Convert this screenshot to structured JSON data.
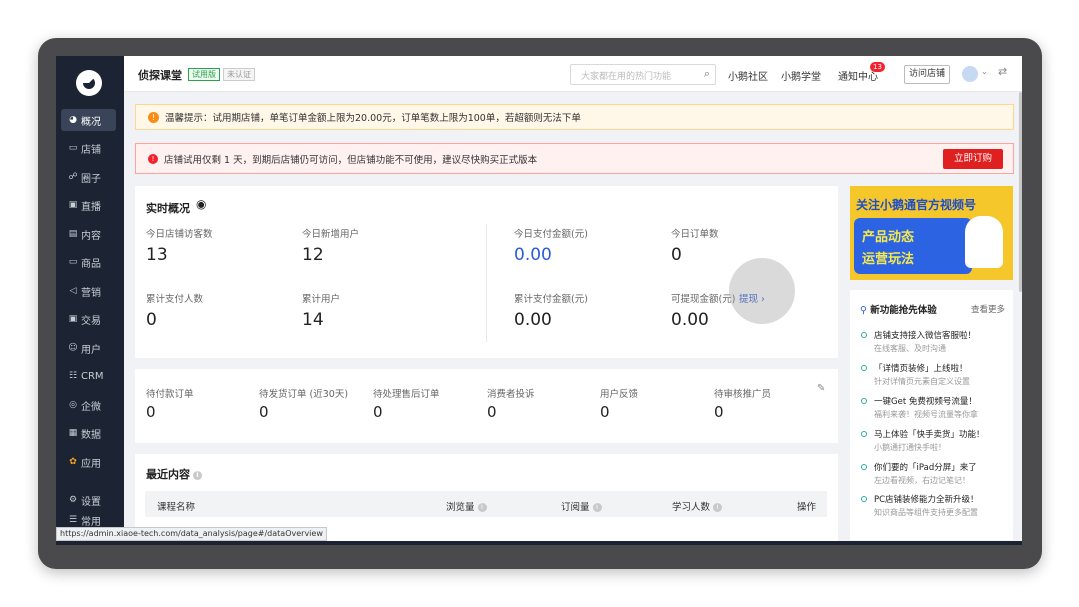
{
  "sidebar": {
    "items": [
      {
        "label": "概况",
        "icon": "pie-chart-icon"
      },
      {
        "label": "店铺",
        "icon": "store-icon"
      },
      {
        "label": "圈子",
        "icon": "community-icon"
      },
      {
        "label": "直播",
        "icon": "live-icon"
      },
      {
        "label": "内容",
        "icon": "content-icon"
      },
      {
        "label": "商品",
        "icon": "goods-icon"
      },
      {
        "label": "营销",
        "icon": "megaphone-icon"
      },
      {
        "label": "交易",
        "icon": "trade-icon"
      },
      {
        "label": "用户",
        "icon": "user-icon"
      },
      {
        "label": "CRM",
        "icon": "crm-icon"
      },
      {
        "label": "企微",
        "icon": "wecom-icon"
      },
      {
        "label": "数据",
        "icon": "data-icon"
      },
      {
        "label": "应用",
        "icon": "apps-icon"
      },
      {
        "label": "设置",
        "icon": "settings-icon"
      },
      {
        "label": "常用",
        "icon": "menu-icon"
      }
    ]
  },
  "topbar": {
    "brand": "侦探课堂",
    "trial_badge": "试用版",
    "unverified_badge": "未认证",
    "search_placeholder": "大家都在用的热门功能",
    "links": [
      "小鹅社区",
      "小鹅学堂",
      "通知中心"
    ],
    "notification_count": "13",
    "visit_store": "访问店铺"
  },
  "banners": {
    "warning": "温馨提示：试用期店铺，单笔订单金额上限为20.00元，订单笔数上限为100单，若超额则无法下单",
    "error": "店铺试用仅剩 1 天，到期后店铺仍可访问，但店铺功能不可使用，建议尽快购买正式版本",
    "buy_button": "立即订购"
  },
  "realtime": {
    "title": "实时概况",
    "stats": [
      {
        "label": "今日店铺访客数",
        "value": "13"
      },
      {
        "label": "今日新增用户",
        "value": "12"
      },
      {
        "label": "今日支付金额(元)",
        "value": "0.00"
      },
      {
        "label": "今日订单数",
        "value": "0"
      },
      {
        "label": "累计支付人数",
        "value": "0"
      },
      {
        "label": "累计用户",
        "value": "14"
      },
      {
        "label": "累计支付金额(元)",
        "value": "0.00"
      },
      {
        "label": "可提现金额(元)",
        "value": "0.00"
      }
    ],
    "withdraw_link": "提现 ›"
  },
  "todo": {
    "items": [
      {
        "label": "待付款订单",
        "value": "0"
      },
      {
        "label": "待发货订单 (近30天)",
        "value": "0"
      },
      {
        "label": "待处理售后订单",
        "value": "0"
      },
      {
        "label": "消费者投诉",
        "value": "0"
      },
      {
        "label": "用户反馈",
        "value": "0"
      },
      {
        "label": "待审核推广员",
        "value": "0"
      }
    ]
  },
  "recent": {
    "title": "最近内容",
    "columns": [
      "课程名称",
      "浏览量",
      "订阅量",
      "学习人数",
      "操作"
    ]
  },
  "promo": {
    "title": "关注小鹅通官方视频号",
    "line1": "产品动态",
    "line2": "运营玩法"
  },
  "features": {
    "title": "新功能抢先体验",
    "more": "查看更多",
    "items": [
      {
        "title": "店铺支持接入微信客服啦！",
        "sub": "在线客服、及时沟通"
      },
      {
        "title": "「详情页装修」上线啦！",
        "sub": "针对详情页元素自定义设置"
      },
      {
        "title": "一键Get 免费视频号流量！",
        "sub": "福利来袭！视频号流量等你拿"
      },
      {
        "title": "马上体验「快手卖货」功能！",
        "sub": "小鹅通打通快手啦！"
      },
      {
        "title": "你们要的「iPad分屏」来了",
        "sub": "左边看视频，右边记笔记！"
      },
      {
        "title": "PC店铺装修能力全新升级！",
        "sub": "知识商品等组件支持更多配置"
      }
    ]
  },
  "status_url": "https://admin.xiaoe-tech.com/data_analysis/page#/dataOverview",
  "colors": {
    "sidebar_bg": "#1c2433",
    "accent_blue": "#2a5bd7",
    "danger_red": "#e02020",
    "warning_orange": "#fa8c16"
  }
}
